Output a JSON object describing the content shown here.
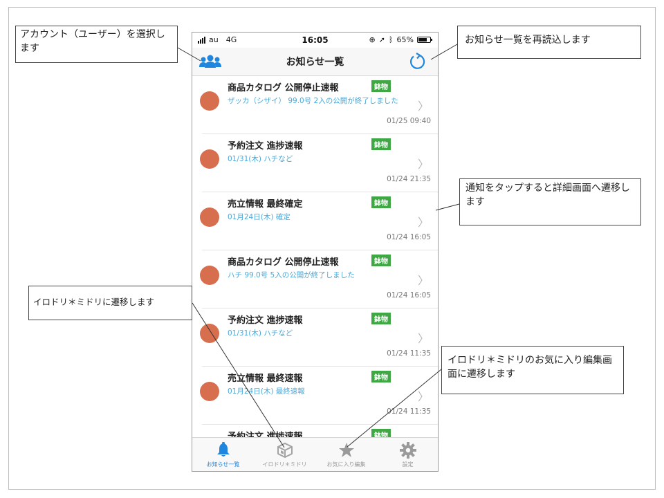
{
  "status_bar": {
    "carrier": "au",
    "network": "4G",
    "time": "16:05",
    "battery": "65%"
  },
  "nav": {
    "title": "お知らせ一覧"
  },
  "notifications": [
    {
      "title": "商品カタログ 公開停止速報",
      "tag": "鉢物",
      "sub": "ザッカ（シザイ） 99.0号 2入の公開が終了しました",
      "time": "01/25 09:40"
    },
    {
      "title": "予約注文 進捗速報",
      "tag": "鉢物",
      "sub": "01/31(木) ハチなど",
      "time": "01/24 21:35"
    },
    {
      "title": "売立情報 最終確定",
      "tag": "鉢物",
      "sub": "01月24日(木) 確定",
      "time": "01/24 16:05"
    },
    {
      "title": "商品カタログ 公開停止速報",
      "tag": "鉢物",
      "sub": "ハチ 99.0号 5入の公開が終了しました",
      "time": "01/24 16:05"
    },
    {
      "title": "予約注文 進捗速報",
      "tag": "鉢物",
      "sub": "01/31(木) ハチなど",
      "time": "01/24 11:35"
    },
    {
      "title": "売立情報 最終速報",
      "tag": "鉢物",
      "sub": "01月24日(木) 最終速報",
      "time": "01/24 11:35"
    },
    {
      "title": "予約注文 進捗速報",
      "tag": "鉢物",
      "sub": "",
      "time": ""
    }
  ],
  "tabs": [
    {
      "label": "お知らせ一覧",
      "icon": "bell-icon",
      "active": true
    },
    {
      "label": "イロドリ＊ミドリ",
      "icon": "box-icon",
      "active": false
    },
    {
      "label": "お気に入り編集",
      "icon": "star-icon",
      "active": false
    },
    {
      "label": "設定",
      "icon": "gear-icon",
      "active": false
    }
  ],
  "callouts": {
    "account": "アカウント（ユーザー）を選択します",
    "reload": "お知らせ一覧を再読込します",
    "detail": "通知をタップすると詳細画面へ遷移します",
    "irodori": "イロドリ＊ミドリに遷移します",
    "favorite": "イロドリ＊ミドリのお気に入り編集画面に遷移します"
  },
  "colors": {
    "accent": "#1f86e0",
    "avatar": "#d76f4f",
    "tag": "#3fa845",
    "subtext": "#4aa8d8"
  }
}
